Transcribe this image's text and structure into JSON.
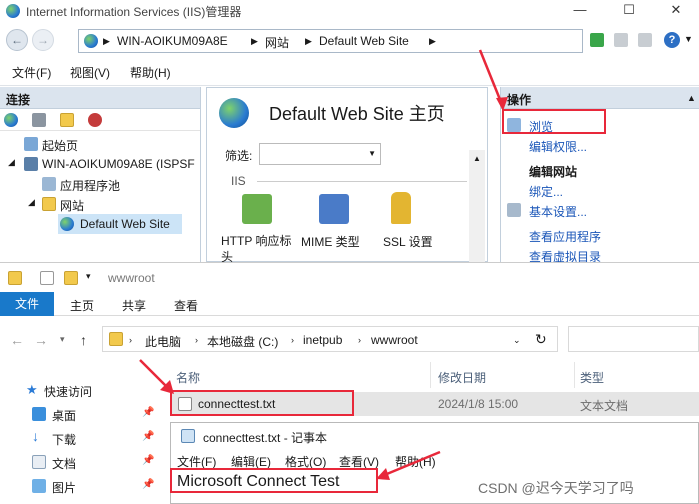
{
  "iis": {
    "title": "Internet Information Services (IIS)管理器",
    "window_buttons": [
      "—",
      "☐",
      "✕"
    ],
    "address": {
      "segments": [
        "WIN-AOIKUM09A8E",
        "网站",
        "Default Web Site"
      ]
    },
    "menu": [
      "文件(F)",
      "视图(V)",
      "帮助(H)"
    ],
    "connections": {
      "header": "连接",
      "tree": [
        "起始页",
        "WIN-AOIKUM09A8E (ISPSF",
        "应用程序池",
        "网站",
        "Default Web Site"
      ]
    },
    "center": {
      "title": "Default Web Site 主页",
      "filter_label": "筛选:",
      "group": "IIS",
      "icons": [
        "HTTP 响应标头",
        "MIME 类型",
        "SSL 设置"
      ]
    },
    "actions": {
      "header": "操作",
      "browse": "浏览",
      "edit_permissions": "编辑权限...",
      "section_edit_site": "编辑网站",
      "bindings": "绑定...",
      "basic_settings": "基本设置...",
      "view_app": "查看应用程序",
      "view_vdir": "查看虚拟目录"
    }
  },
  "explorer": {
    "title": "wwwroot",
    "tabs": [
      "文件",
      "主页",
      "共享",
      "查看"
    ],
    "address": [
      "此电脑",
      "本地磁盘 (C:)",
      "inetpub",
      "wwwroot"
    ],
    "nav": [
      "快速访问",
      "桌面",
      "下载",
      "文档",
      "图片"
    ],
    "columns": [
      "名称",
      "修改日期",
      "类型"
    ],
    "rows": [
      {
        "name": "connecttest.txt",
        "date": "2024/1/8 15:00",
        "type": "文本文档"
      }
    ]
  },
  "notepad": {
    "title": "connecttest.txt - 记事本",
    "menu": [
      "文件(F)",
      "编辑(E)",
      "格式(O)",
      "查看(V)",
      "帮助(H)"
    ],
    "content": "Microsoft Connect Test"
  },
  "watermark": "CSDN @迟今天学习了吗",
  "colors": {
    "accent": "#1979ca",
    "highlight": "#e8283a",
    "link": "#1a56b8"
  }
}
